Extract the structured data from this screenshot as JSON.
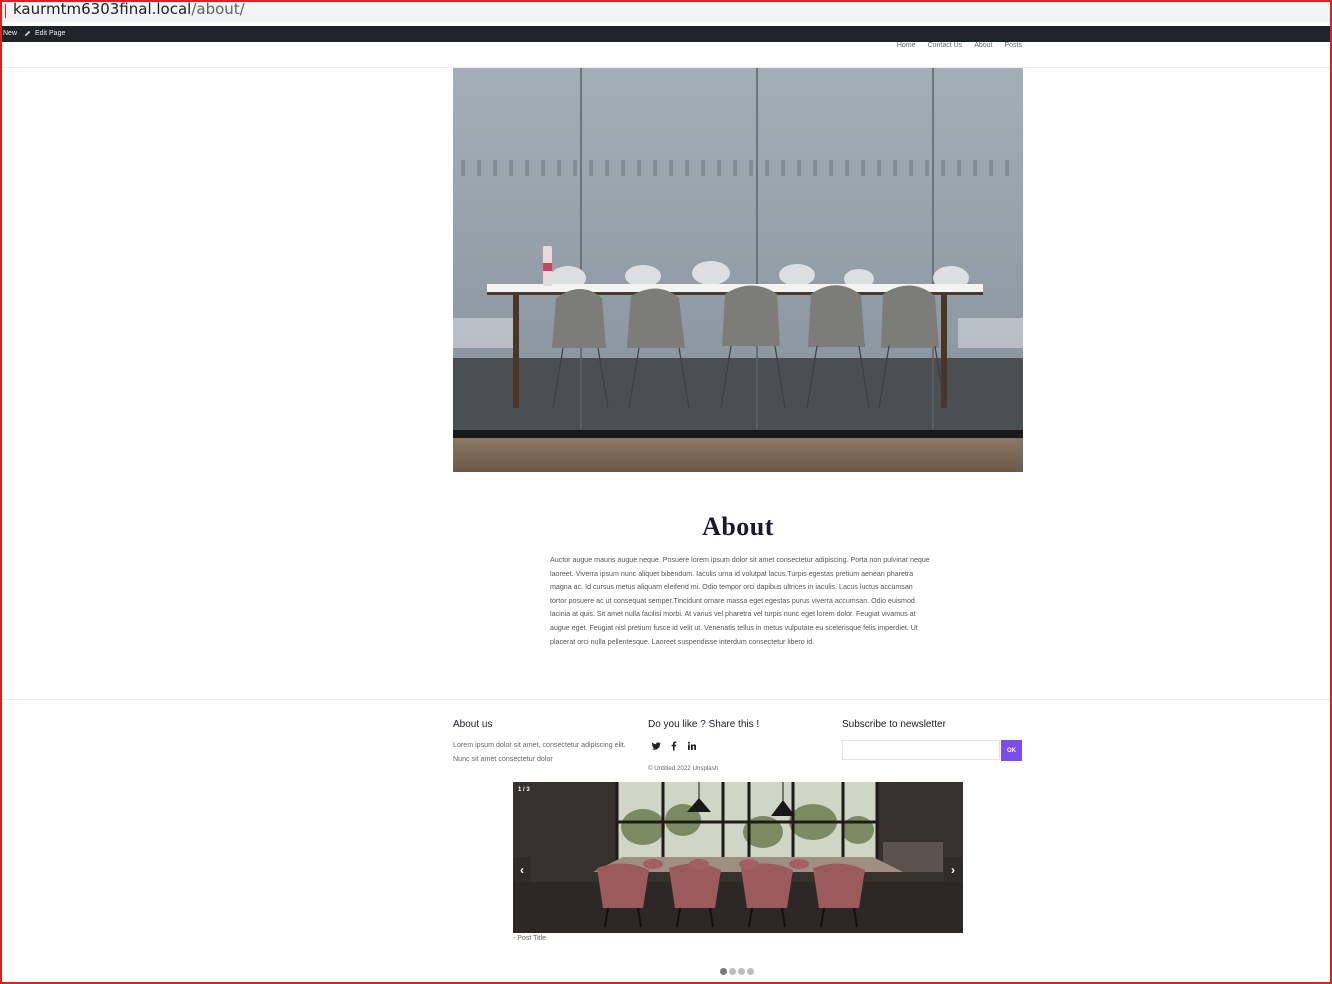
{
  "browser": {
    "url_host": "kaurmtm6303final.local",
    "url_path": "/about/"
  },
  "adminbar": {
    "new_label": "New",
    "edit_label": "Edit Page"
  },
  "nav": {
    "items": [
      "Home",
      "Contact Us",
      "About",
      "Posts"
    ]
  },
  "hero": {
    "subject": "conference room with white chairs behind glass"
  },
  "about": {
    "title": "About",
    "body": "Auctor augue mauris augue neque. Posuere lorem ipsum dolor sit amet consectetur adipiscing. Porta non pulvinar neque laoreet. Viverra ipsum nunc aliquet bibendum. Iaculis urna id volutpat lacus.Turpis egestas pretium aenean pharetra magna ac. Id cursus metus aliquam eleifend mi. Odio tempor orci dapibus ultrices in iaculis. Lacus luctus accumsan tortor posuere ac ut consequat semper.Tincidunt ornare massa eget egestas purus viverra accumsan. Odio euismod lacinia at quis. Sit amet nulla facilisi morbi. At varius vel pharetra vel turpis nunc eget lorem dolor. Feugiat vivamus at augue eget. Feugiat nisl pretium fusce id velit ut. Venenatis tellus in metus vulputate eu scelerisque felis imperdiet. Ut placerat orci nulla pellentesque. Laoreet suspendisse interdum consectetur libero id."
  },
  "footer": {
    "about_title": "About us",
    "about_text": "Lorem ipsum dolor sit amet, consectetur adipiscing elit. Nunc sit amet consectetur dolor",
    "share_title": "Do you like ? Share this !",
    "social_icons": [
      "twitter-icon",
      "facebook-icon",
      "linkedin-icon"
    ],
    "copyright": "© Untitled 2022 Unsplash",
    "newsletter_title": "Subscribe to newsletter",
    "newsletter_placeholder": "",
    "newsletter_button": "OK"
  },
  "slider": {
    "counter": "1 / 3",
    "prev_label": "‹",
    "next_label": "›",
    "post_title": "- Post Title",
    "dots": 4,
    "active_dot": 1
  },
  "colors": {
    "adminbar": "#1d2327",
    "accent": "#7b4cf0",
    "frame": "#e0201e"
  }
}
